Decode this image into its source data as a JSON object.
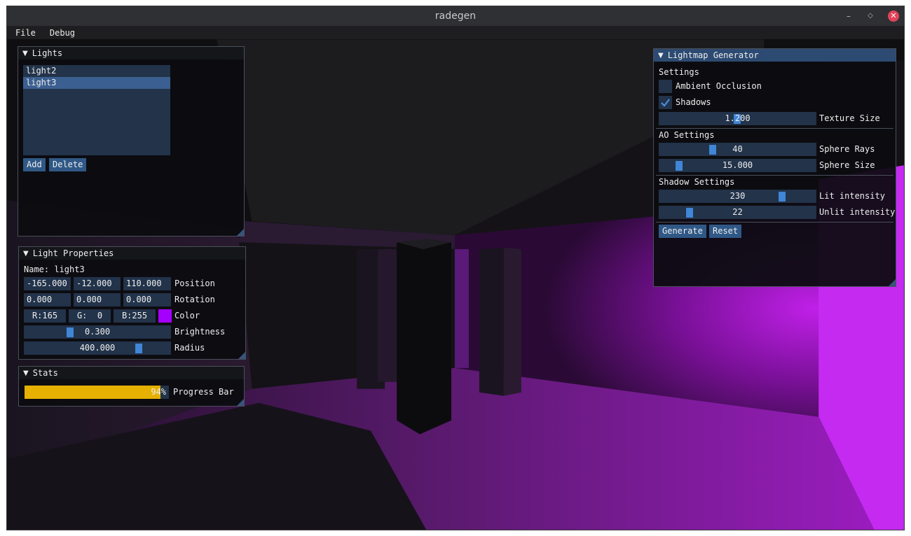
{
  "app": {
    "title": "radegen",
    "menu": [
      "File",
      "Debug"
    ],
    "window_controls": [
      "minimize-icon",
      "maximize-icon",
      "close-icon"
    ]
  },
  "lights_panel": {
    "title": "Lights",
    "items": [
      "light2",
      "light3"
    ],
    "selected": "light3",
    "add_label": "Add",
    "delete_label": "Delete"
  },
  "props_panel": {
    "title": "Light Properties",
    "name_line": "Name: light3",
    "position": [
      "-165.000",
      "-12.000",
      "110.000"
    ],
    "position_label": "Position",
    "rotation": [
      "0.000",
      "0.000",
      "0.000"
    ],
    "rotation_label": "Rotation",
    "color": [
      "R:165",
      "G:  0",
      "B:255"
    ],
    "color_label": "Color",
    "color_swatch": "#a500ff",
    "brightness": "0.300",
    "brightness_label": "Brightness",
    "radius": "400.000",
    "radius_label": "Radius"
  },
  "stats_panel": {
    "title": "Stats",
    "progress_text": "94%",
    "progress_value": 0.94,
    "progress_label": "Progress Bar",
    "progress_color": "#e6b000"
  },
  "lightmap_panel": {
    "title": "Lightmap Generator",
    "settings_header": "Settings",
    "ambient_occlusion_label": "Ambient Occlusion",
    "ambient_occlusion_checked": false,
    "shadows_label": "Shadows",
    "shadows_checked": true,
    "texture_size": "1.200",
    "texture_size_label": "Texture Size",
    "ao_header": "AO Settings",
    "sphere_rays": "40",
    "sphere_rays_label": "Sphere Rays",
    "sphere_size": "15.000",
    "sphere_size_label": "Sphere Size",
    "shadow_header": "Shadow Settings",
    "lit_intensity": "230",
    "lit_intensity_label": "Lit intensity",
    "unlit_intensity": "22",
    "unlit_intensity_label": "Unlit intensity",
    "generate_label": "Generate",
    "reset_label": "Reset"
  },
  "colors": {
    "accent": "#4085d6",
    "frame_bg": "#22334a",
    "button": "#2f5886",
    "scene_light": "#b21fd6"
  }
}
